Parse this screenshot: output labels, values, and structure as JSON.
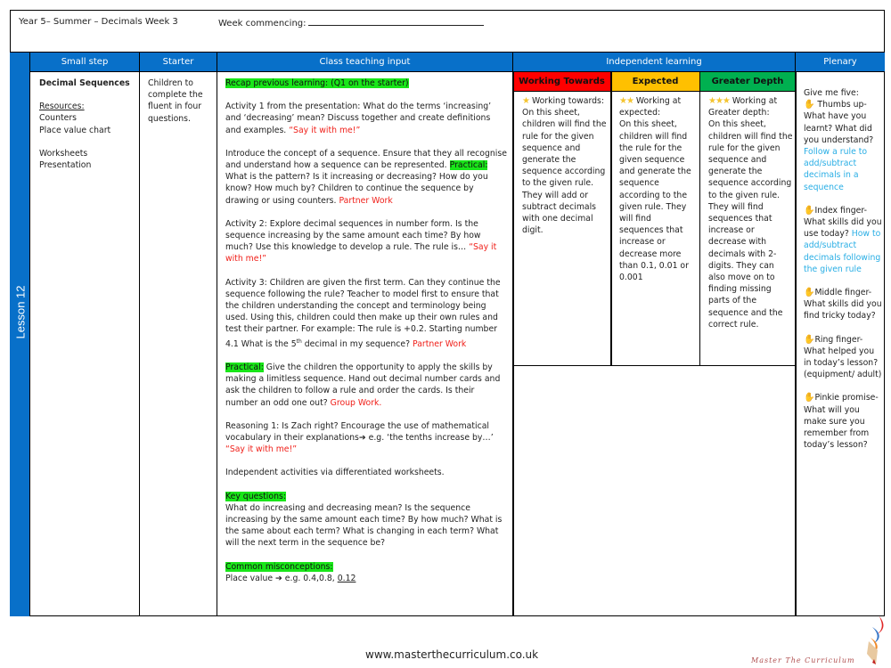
{
  "header": {
    "title": "Year 5– Summer – Decimals Week 3",
    "week_commencing_label": "Week commencing:"
  },
  "lesson_label": "Lesson  12",
  "columns": {
    "small_step": "Small step",
    "starter": "Starter",
    "class_teaching": "Class teaching input",
    "independent": "Independent learning",
    "plenary": "Plenary"
  },
  "sub_columns": {
    "working_towards": "Working Towards",
    "expected": "Expected",
    "greater_depth": "Greater Depth"
  },
  "colors": {
    "header_blue": "#0870c9",
    "working_towards": "#fe0000",
    "expected": "#ffc000",
    "greater_depth": "#00b050",
    "highlight_green": "#19e619",
    "emphasis_red": "#f0201a",
    "objective_blue": "#29aee5"
  },
  "small_step": {
    "title": "Decimal Sequences",
    "resources_label": "Resources:",
    "resources": [
      "Counters",
      "Place value chart"
    ],
    "materials": [
      "Worksheets",
      "Presentation"
    ]
  },
  "starter": {
    "text": "Children to complete the fluent in four questions."
  },
  "teaching": {
    "recap": "Recap previous learning: (Q1 on the starter)",
    "activity1": "Activity 1 from the presentation: What do the terms ‘increasing’ and ‘decreasing’ mean? Discuss together and create definitions and examples.",
    "activity1_tag": "“Say it with me!”",
    "intro_a": "Introduce the concept of a sequence. Ensure that they all recognise and understand how a sequence can be represented.",
    "practical_label": "Practical:",
    "intro_b": "What is the pattern? Is it increasing or decreasing? How do you know? How much by? Children to continue the sequence by drawing or using counters.",
    "intro_tag": "Partner Work",
    "activity2": "Activity 2: Explore decimal sequences in number form. Is the sequence increasing by the same amount each time? By how much? Use this knowledge to develop a rule. The rule is…",
    "activity2_tag": "“Say it with me!”",
    "activity3_a": "Activity 3: Children are given the first term. Can they continue the sequence following the rule? Teacher to model first to ensure that the children understanding the concept and terminology being used. Using this, children could then make up their own rules and test their partner. For example: The rule is +0.2. Starting number 4.1 What is the 5",
    "activity3_sup": "th",
    "activity3_b": "decimal in my sequence?",
    "activity3_tag": "Partner Work",
    "practical2_label": "Practical:",
    "practical2": "Give the children the opportunity to apply the skills by making a limitless sequence. Hand out decimal number cards and ask the children to follow a rule and order the cards. Is their number an odd one out?",
    "practical2_tag": "Group Work.",
    "reasoning": "Reasoning 1: Is Zach right? Encourage the use of mathematical vocabulary in their explanations➔ e.g. ‘the tenths increase by…’",
    "reasoning_tag": "“Say it with me!”",
    "independent": "Independent activities via differentiated worksheets.",
    "key_questions_label": "Key questions:",
    "key_questions": "What do increasing and decreasing mean? Is the sequence increasing by the same amount each time? By how much? What is the same about each term? What is changing in each term?  What will the next term in the sequence be?",
    "misconceptions_label": "Common misconceptions:",
    "misconceptions": "Place value ➔ e.g. 0.4,0.8,",
    "misconceptions_underlined": "0.12"
  },
  "independent": {
    "working_towards": {
      "stars": "★",
      "heading": "Working towards:",
      "text": "On this sheet, children will  find the rule for the given sequence and generate the sequence according to the given rule. They will add or subtract decimals with one decimal digit."
    },
    "expected": {
      "stars": "★★",
      "heading": "Working at expected:",
      "text": "On this sheet, children will  find the rule for the given sequence and generate the sequence according to the given rule.  They will find sequences that increase or decrease more than 0.1, 0.01 or 0.001"
    },
    "greater_depth": {
      "stars": "★★★",
      "heading": "Working at Greater depth:",
      "text": "On this sheet, children will  find the rule for the given sequence and generate the sequence according to the given rule. They will find sequences that increase or decrease with decimals with 2-digits. They can also move on to finding missing parts of the sequence and the correct rule."
    }
  },
  "plenary": {
    "intro": "Give me five:",
    "items": [
      {
        "icon": "hand-icon",
        "text": "Thumbs up- What have you learnt? What did you understand?",
        "objective": "Follow a rule to add/subtract decimals in a sequence"
      },
      {
        "icon": "hand-icon",
        "text": "Index finger- What skills did you use today?",
        "objective": "How to add/subtract decimals following the given rule"
      },
      {
        "icon": "hand-icon",
        "text": "Middle finger- What skills did you find tricky today?",
        "objective": ""
      },
      {
        "icon": "hand-icon",
        "text": "Ring finger- What helped you in today’s lesson? (equipment/ adult)",
        "objective": ""
      },
      {
        "icon": "hand-icon",
        "text": "Pinkie promise- What will you make sure you remember from today’s lesson?",
        "objective": ""
      }
    ]
  },
  "footer": {
    "url": "www.masterthecurriculum.co.uk",
    "logo_text": "Master The Curriculum"
  }
}
